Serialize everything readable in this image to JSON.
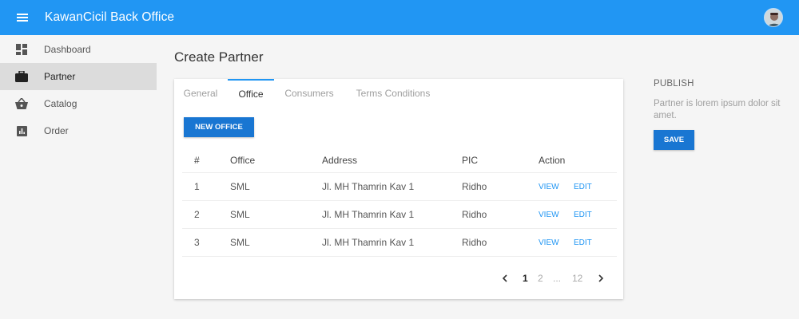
{
  "app": {
    "title": "KawanCicil Back Office"
  },
  "colors": {
    "primary": "#2196f3",
    "button": "#1976d2"
  },
  "sidebar": {
    "items": [
      {
        "label": "Dashboard",
        "icon": "dashboard-icon"
      },
      {
        "label": "Partner",
        "icon": "briefcase-icon",
        "active": true
      },
      {
        "label": "Catalog",
        "icon": "basket-icon"
      },
      {
        "label": "Order",
        "icon": "bar-chart-icon"
      }
    ]
  },
  "page": {
    "title": "Create Partner"
  },
  "tabs": [
    {
      "label": "General"
    },
    {
      "label": "Office",
      "active": true
    },
    {
      "label": "Consumers"
    },
    {
      "label": "Terms Conditions"
    }
  ],
  "office": {
    "new_button": "NEW OFFICE",
    "columns": [
      "#",
      "Office",
      "Address",
      "PIC",
      "Action"
    ],
    "rows": [
      {
        "num": "1",
        "office": "SML",
        "address": "Jl. MH Thamrin Kav 1",
        "pic": "Ridho"
      },
      {
        "num": "2",
        "office": "SML",
        "address": "Jl. MH Thamrin Kav 1",
        "pic": "Ridho"
      },
      {
        "num": "3",
        "office": "SML",
        "address": "Jl. MH Thamrin Kav 1",
        "pic": "Ridho"
      }
    ],
    "view_label": "VIEW",
    "edit_label": "EDIT"
  },
  "pagination": {
    "pages": [
      "1",
      "2",
      "...",
      "12"
    ],
    "current": "1"
  },
  "publish": {
    "title": "PUBLISH",
    "description": "Partner is lorem ipsum dolor sit amet.",
    "save_label": "SAVE"
  }
}
